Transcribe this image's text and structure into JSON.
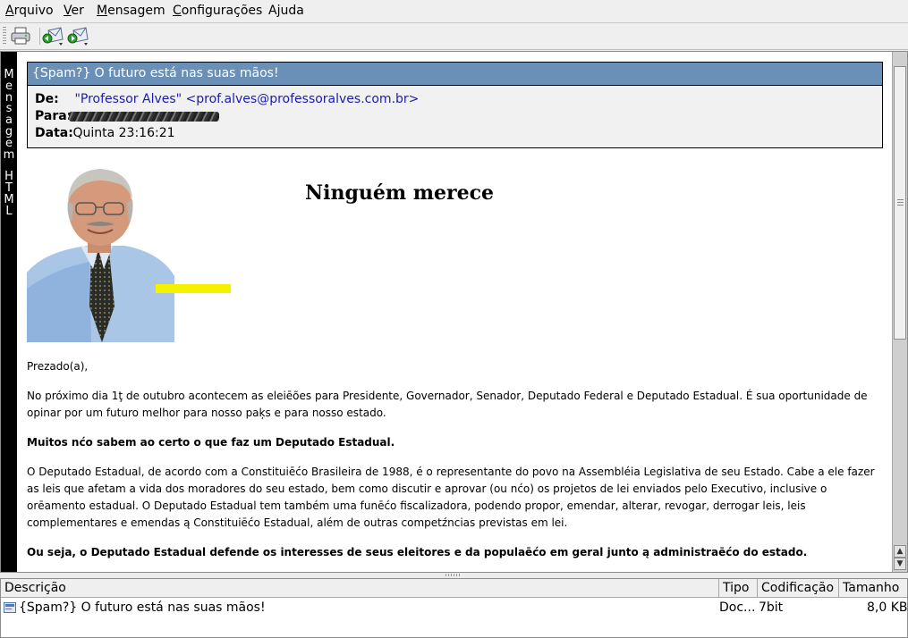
{
  "menubar": {
    "items": [
      {
        "ul": "A",
        "rest": "rquivo"
      },
      {
        "ul": "V",
        "rest": "er"
      },
      {
        "ul": "M",
        "rest": "ensagem"
      },
      {
        "ul": "C",
        "rest": "onfigurações"
      },
      {
        "ul": "",
        "rest": "Ajuda"
      }
    ]
  },
  "toolbar": {
    "icons": [
      "printer-icon",
      "reply-icon",
      "forward-icon"
    ]
  },
  "sidebar": {
    "label": "Mensagem HTML"
  },
  "header": {
    "subject": "{Spam?} O futuro está nas suas mãos!",
    "from_label": "De:",
    "from_value": "\"Professor Alves\" <prof.alves@professoralves.com.br>",
    "to_label": "Para:",
    "date_label": "Data:",
    "date_value": "Quinta 23:16:21"
  },
  "body": {
    "headline": "Ninguém merece",
    "greeting": "Prezado(a),",
    "p1": "No próximo dia 1ţ de outubro acontecem as eleiēões para Presidente, Governador, Senador, Deputado Federal e Deputado Estadual. É sua oportunidade de opinar por um futuro melhor para nosso paķs e para nosso estado.",
    "p2": "Muitos nćo sabem ao certo o que faz um Deputado Estadual.",
    "p3": "O Deputado Estadual, de acordo com a Constituiēćo Brasileira de 1988, é o representante do povo na Assembléia Legislativa de seu Estado. Cabe a ele fazer as leis que afetam a vida dos moradores do seu estado, bem como discutir e aprovar (ou nćo) os projetos de lei enviados pelo Executivo, inclusive o orēamento estadual. O Deputado Estadual tem também uma funēćo fiscalizadora, podendo propor, emendar, alterar, revogar, derrogar leis, leis complementares e emendas ą Constituiēćo Estadual, além de outras competźncias previstas em lei.",
    "p4": "Ou seja, o Deputado Estadual defende os interesses de seus eleitores e da populaēćo em geral junto ą administraēćo do estado."
  },
  "attachments": {
    "columns": [
      "Descrição",
      "Tipo",
      "Codificação",
      "Tamanho"
    ],
    "rows": [
      {
        "description": "{Spam?} O futuro está nas suas mãos!",
        "type": "Doc...",
        "encoding": "7bit",
        "size": "8,0 KB"
      }
    ]
  },
  "colors": {
    "subject_bar": "#6a90b8",
    "sidebar": "#000000",
    "highlight_bar": "#f5f200",
    "link": "#1b1bb3"
  }
}
